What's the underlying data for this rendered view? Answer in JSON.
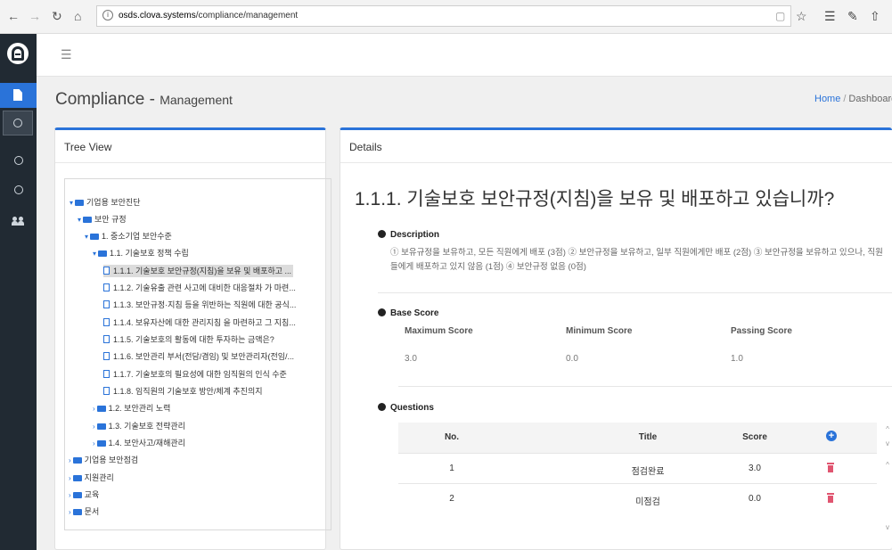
{
  "browser": {
    "url_domain": "osds.clova.systems",
    "url_path": "/compliance/management",
    "icons": [
      "back-icon",
      "forward-icon",
      "refresh-icon",
      "home-icon",
      "reading-view-icon",
      "favorite-star-icon",
      "favorites-list-icon",
      "pen-icon",
      "share-icon"
    ]
  },
  "sidebar": {
    "logo_icon": "app-logo-icon",
    "items": [
      {
        "icon": "document-icon",
        "active": true
      },
      {
        "icon": "circle-icon"
      },
      {
        "icon": "circle-icon"
      },
      {
        "icon": "circle-icon"
      },
      {
        "icon": "users-icon"
      }
    ]
  },
  "topbar": {
    "menu_icon": "☰"
  },
  "page": {
    "title": "Compliance -",
    "subtitle": "Management",
    "breadcrumb": {
      "home": "Home",
      "sep": "/",
      "current": "Dashboard v"
    }
  },
  "tree": {
    "title": "Tree View",
    "items": [
      {
        "label": "기업용 보안진단",
        "type": "folder",
        "state": "open"
      },
      {
        "label": "보안 규정",
        "type": "folder",
        "state": "open"
      },
      {
        "label": "1. 중소기업 보안수준",
        "type": "folder",
        "state": "open"
      },
      {
        "label": "1.1. 기술보호 정책 수립",
        "type": "folder",
        "state": "open"
      },
      {
        "label": "1.1.1. 기술보호 보안규정(지침)을 보유 및 배포하고 ...",
        "type": "file",
        "selected": true
      },
      {
        "label": "1.1.2. 기술유출 관련 사고에 대비한 대응절차 가 마련...",
        "type": "file"
      },
      {
        "label": "1.1.3. 보안규정·지침 등을 위반하는 직원에 대한 공식...",
        "type": "file"
      },
      {
        "label": "1.1.4. 보유자산에 대한 관리지침 을 마련하고 그 지침...",
        "type": "file"
      },
      {
        "label": "1.1.5. 기술보호의 활동에 대한 투자하는 금액은?",
        "type": "file"
      },
      {
        "label": "1.1.6. 보안관리 부서(전담/겸임) 및 보안관리자(전임/...",
        "type": "file"
      },
      {
        "label": "1.1.7. 기술보호의 필요성에 대한 임직원의 인식 수준",
        "type": "file"
      },
      {
        "label": "1.1.8. 임직원의 기술보호 방안/체계 추진의지",
        "type": "file"
      },
      {
        "label": "1.2. 보안관리 노력",
        "type": "folder",
        "state": "closed"
      },
      {
        "label": "1.3. 기술보호 전략관리",
        "type": "folder",
        "state": "closed"
      },
      {
        "label": "1.4. 보안사고/재해관리",
        "type": "folder",
        "state": "closed"
      },
      {
        "label": "기업용 보안점검",
        "type": "folder",
        "state": "closed"
      },
      {
        "label": "지원관리",
        "type": "folder",
        "state": "closed"
      },
      {
        "label": "교육",
        "type": "folder",
        "state": "closed"
      },
      {
        "label": "문서",
        "type": "folder",
        "state": "closed"
      }
    ]
  },
  "details": {
    "title": "Details",
    "question": "1.1.1. 기술보호 보안규정(지침)을 보유 및 배포하고 있습니까?",
    "description": {
      "label": "Description",
      "text": "① 보유규정을 보유하고, 모든 직원에게 배포 (3점) ② 보안규정을 보유하고, 일부 직원에게만 배포 (2점) ③ 보안규정을 보유하고 있으나, 직원들에게 배포하고 있지 않음 (1점) ④ 보안규정 없음 (0점)"
    },
    "base_score": {
      "label": "Base Score",
      "headers": [
        "Maximum Score",
        "Minimum Score",
        "Passing Score"
      ],
      "values": [
        "3.0",
        "0.0",
        "1.0"
      ]
    },
    "questions": {
      "label": "Questions",
      "columns": [
        "No.",
        "Title",
        "Score"
      ],
      "add_icon": "+",
      "rows": [
        {
          "no": "1",
          "title": "점검완료",
          "score": "3.0"
        },
        {
          "no": "2",
          "title": "미점검",
          "score": "0.0"
        }
      ],
      "colors": {
        "accent": "#2a73d9",
        "delete": "#e05570"
      }
    }
  }
}
